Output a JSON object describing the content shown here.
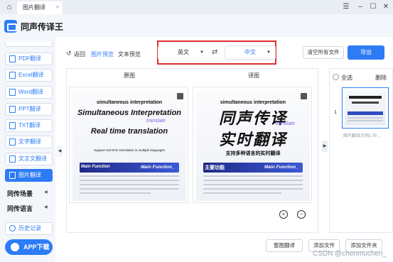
{
  "window": {
    "tab_title": "图片翻译",
    "tab_close": "×",
    "controls": {
      "menu": "☰",
      "minimize": "–",
      "maximize": "☐",
      "close": "✕"
    }
  },
  "app": {
    "title": "同声传译王"
  },
  "sidebar": {
    "items": [
      {
        "label": "PDF翻译",
        "icon": "pdf-icon"
      },
      {
        "label": "Excel翻译",
        "icon": "excel-icon"
      },
      {
        "label": "Word翻译",
        "icon": "word-icon"
      },
      {
        "label": "PPT翻译",
        "icon": "ppt-icon"
      },
      {
        "label": "TXT翻译",
        "icon": "txt-icon"
      },
      {
        "label": "文字翻译",
        "icon": "text-icon"
      },
      {
        "label": "文言文翻译",
        "icon": "classical-icon"
      },
      {
        "label": "图片翻译",
        "icon": "image-icon",
        "active": true
      }
    ],
    "groups": [
      {
        "label": "同传场景"
      },
      {
        "label": "同传语言"
      }
    ],
    "history": "历史记录",
    "download": "APP下载"
  },
  "toolbar": {
    "back": "返回",
    "image_preview": "图片预览",
    "text_preview": "文本预览",
    "source_lang": "英文",
    "target_lang": "中文",
    "swap_icon": "⇄",
    "clear_all": "清空所有文件",
    "export": "导出"
  },
  "compare": {
    "original_header": "原图",
    "translated_header": "译图",
    "original": {
      "subtitle": "simultaneous interpretation",
      "headline": "Simultaneous Interpretation",
      "accent": "translate",
      "realtime": "Real time translation",
      "tagline": "Support real-time translation in multiple languages",
      "bar_left": "Main Function",
      "bar_right": "Main Function_"
    },
    "translated": {
      "subtitle": "simultaneous interpretation",
      "headline": "同声传译",
      "accent": "translate",
      "realtime": "实时翻译",
      "tagline": "支持多种语言的实时翻译",
      "bar_left": "主要功能",
      "bar_right": "Main Function_"
    }
  },
  "right_panel": {
    "select_all": "全选",
    "delete": "删除",
    "thumb_index": "1",
    "thumb_caption": "图片翻译示例1-中…"
  },
  "bottom": {
    "translate_all": "整图翻译",
    "add_file": "添加文件",
    "add_folder": "添加文件夹"
  },
  "watermark": "CSDN @chenmuchen_"
}
